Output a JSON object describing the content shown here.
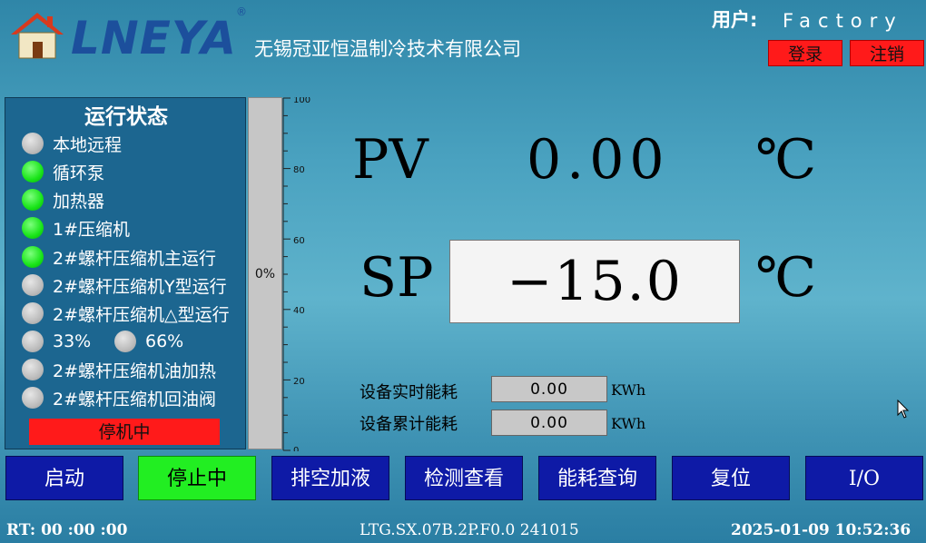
{
  "header": {
    "logo_text": "LNEYA",
    "logo_reg": "®",
    "company": "无锡冠亚恒温制冷技术有限公司",
    "user_label": "用户:",
    "user_value": "Factory",
    "login_label": "登录",
    "logout_label": "注销"
  },
  "status": {
    "title": "运行状态",
    "items": [
      {
        "label": "本地远程",
        "state": "off"
      },
      {
        "label": "循环泵",
        "state": "on"
      },
      {
        "label": "加热器",
        "state": "on"
      },
      {
        "label": "1#压缩机",
        "state": "on"
      },
      {
        "label": "2#螺杆压缩机主运行",
        "state": "on"
      },
      {
        "label": "2#螺杆压缩机Y型运行",
        "state": "off"
      },
      {
        "label": "2#螺杆压缩机△型运行",
        "state": "off"
      },
      {
        "label": "33%",
        "state": "off"
      },
      {
        "label": "66%",
        "state": "off"
      },
      {
        "label": "2#螺杆压缩机油加热",
        "state": "off"
      },
      {
        "label": "2#螺杆压缩机回油阀",
        "state": "off"
      }
    ],
    "badge": "停机中"
  },
  "gauge": {
    "percent_label": "0%",
    "level_percent": 0,
    "ticks": [
      "100",
      "80",
      "60",
      "40",
      "20",
      "0"
    ]
  },
  "readout": {
    "pv_label": "PV",
    "pv_value": "0.00",
    "pv_unit": "℃",
    "sp_label": "SP",
    "sp_value": "−15.0",
    "sp_unit": "℃"
  },
  "energy": {
    "realtime_label": "设备实时能耗",
    "realtime_value": "0.00",
    "realtime_unit": "KWh",
    "total_label": "设备累计能耗",
    "total_value": "0.00",
    "total_unit": "KWh"
  },
  "buttons": {
    "start": "启动",
    "stop": "停止中",
    "drain": "排空加液",
    "check": "检测查看",
    "energy": "能耗查询",
    "reset": "复位",
    "io": "I/O"
  },
  "footer": {
    "rt": "RT: 00 :00 :00",
    "version": "LTG.SX.07B.2P.F0.0 241015",
    "datetime": "2025-01-09 10:52:36"
  },
  "colors": {
    "accent_green": "#22ee22",
    "alarm_red": "#ff1a1a",
    "button_blue": "#0e1aa6",
    "logo_blue": "#1c4f9c"
  }
}
